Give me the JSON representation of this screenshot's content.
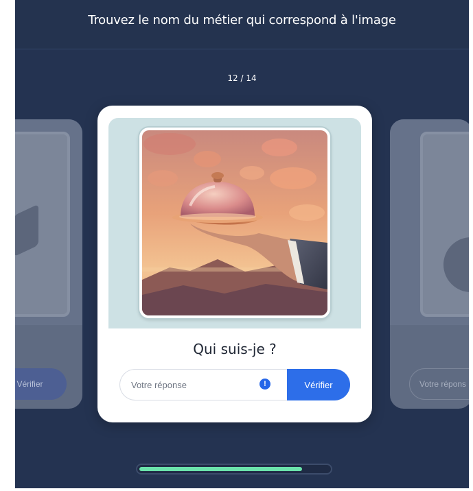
{
  "header": {
    "title": "Trouvez le nom du métier qui correspond à l'image"
  },
  "quiz": {
    "counter": "12 / 14",
    "current": 12,
    "total": 14,
    "progress_fraction": 0.86
  },
  "card": {
    "title": "Qui suis-je ?",
    "answer_placeholder": "Votre réponse",
    "verify_label": "Vérifier",
    "hint_icon": "info-icon"
  },
  "side_cards": {
    "left_verify_label": "Vérifier",
    "right_input_placeholder": "Votre répons"
  },
  "colors": {
    "background": "#243351",
    "accent": "#2d6ee9",
    "progress": "#6be3ab"
  }
}
